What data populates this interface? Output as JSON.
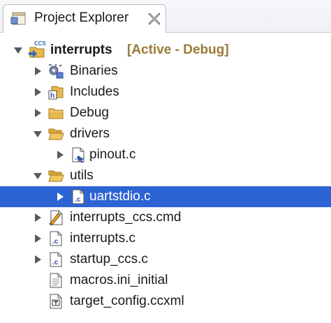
{
  "view": {
    "title": "Project Explorer",
    "tab_icon": "project-explorer-icon",
    "close_icon": "close-icon"
  },
  "project": {
    "name": "interrupts",
    "decoration": "[Active - Debug]",
    "icon": "ccs-project-icon",
    "badge": "CCS"
  },
  "tree": [
    {
      "label": "Binaries",
      "icon": "binaries-icon",
      "expanded": false
    },
    {
      "label": "Includes",
      "icon": "includes-icon",
      "expanded": false
    },
    {
      "label": "Debug",
      "icon": "folder-icon",
      "expanded": false
    },
    {
      "label": "drivers",
      "icon": "folder-open-icon",
      "expanded": true
    },
    {
      "label": "pinout.c",
      "icon": "c-source-file-icon",
      "expanded": false
    },
    {
      "label": "utils",
      "icon": "folder-open-icon",
      "expanded": true
    },
    {
      "label": "uartstdio.c",
      "icon": "c-source-file-icon",
      "expanded": false,
      "selected": true
    },
    {
      "label": "interrupts_ccs.cmd",
      "icon": "linker-cmd-file-icon",
      "expanded": false
    },
    {
      "label": "interrupts.c",
      "icon": "c-source-file-icon",
      "expanded": false
    },
    {
      "label": "startup_ccs.c",
      "icon": "c-source-file-icon",
      "expanded": false
    },
    {
      "label": "macros.ini_initial",
      "icon": "text-file-icon"
    },
    {
      "label": "target_config.ccxml",
      "icon": "target-config-file-icon"
    }
  ],
  "colors": {
    "selection": "#2d64d4",
    "decoration": "#9a7a3a",
    "folder": "#e8b84a"
  }
}
